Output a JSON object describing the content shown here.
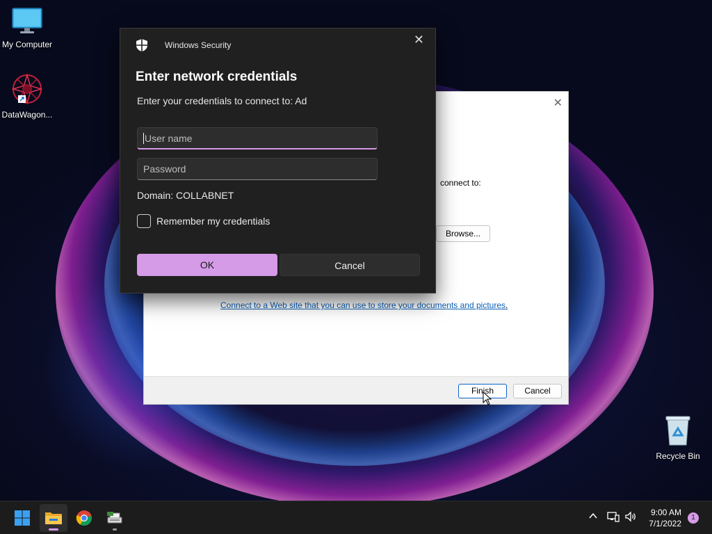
{
  "desktop": {
    "icons": [
      {
        "label": "My Computer",
        "icon": "monitor-icon"
      },
      {
        "label": "DataWagon...",
        "icon": "datawagon-app-icon"
      },
      {
        "label": "Recycle Bin",
        "icon": "recycle-bin-icon"
      }
    ]
  },
  "wizard": {
    "connect_text": "connect to:",
    "browse_label": "Browse...",
    "link_text": "Connect to a Web site that you can use to store your documents and pictures",
    "link_period": ".",
    "finish_label": "Finish",
    "cancel_label": "Cancel"
  },
  "security_dialog": {
    "app_title": "Windows Security",
    "heading": "Enter network credentials",
    "subtitle": "Enter your credentials to connect to: Ad",
    "username_placeholder": "User name",
    "password_placeholder": "Password",
    "domain": "Domain: COLLABNET",
    "remember_label": "Remember my credentials",
    "remember_checked": false,
    "ok_label": "OK",
    "cancel_label": "Cancel",
    "accent_color": "#d59be6"
  },
  "taskbar": {
    "apps": [
      "start-icon",
      "file-explorer-icon",
      "chrome-icon",
      "app-icon"
    ],
    "time": "9:00 AM",
    "date": "7/1/2022",
    "notification_count": "1"
  }
}
